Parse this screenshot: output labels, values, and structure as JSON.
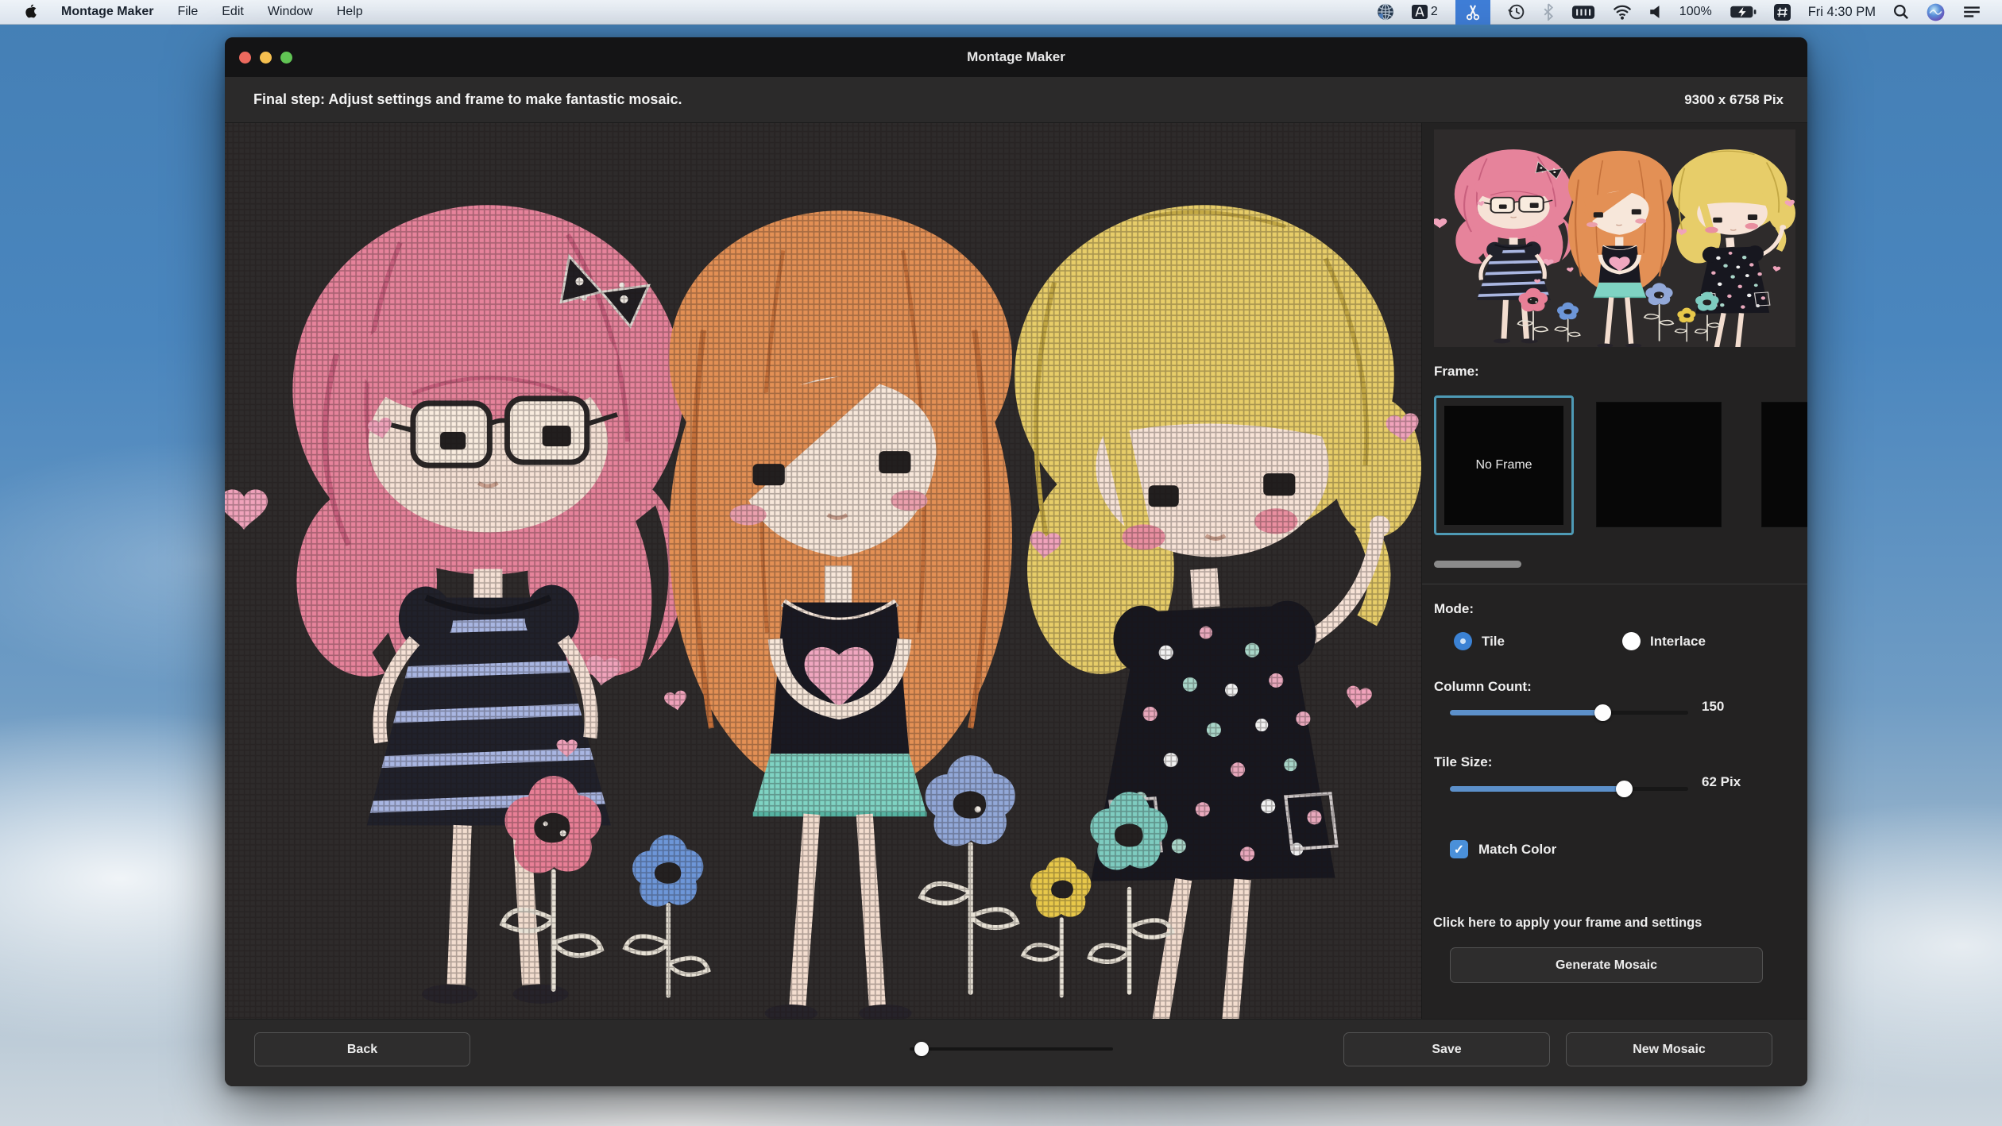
{
  "colors": {
    "accent_blue": "#4a90d9",
    "slider_blue": "#5c90ca",
    "frame_selection": "#4e9ab5",
    "menubar_highlight": "#3f7ed8"
  },
  "menu_bar": {
    "app_name": "Montage Maker",
    "menus": [
      "File",
      "Edit",
      "Window",
      "Help"
    ],
    "status": {
      "adobe_badge": "2",
      "battery_percent": "100%",
      "clock": "Fri 4:30 PM",
      "icons": [
        "globe-icon",
        "adobe-icon",
        "scissors-icon",
        "time-machine-icon",
        "bluetooth-icon",
        "keyboard-brightness-icon",
        "wifi-icon",
        "volume-icon",
        "battery-charging-icon",
        "keypad-icon",
        "spotlight-search-icon",
        "siri-icon",
        "notification-center-icon"
      ]
    }
  },
  "window": {
    "title": "Montage Maker",
    "header": {
      "instruction": "Final step: Adjust settings and frame to make fantastic mosaic.",
      "image_size": "9300 x 6758 Pix"
    },
    "sidebar": {
      "frame_section": {
        "label": "Frame:",
        "options": [
          {
            "label": "No Frame",
            "selected": true
          },
          {
            "label": "",
            "selected": false
          },
          {
            "label": "",
            "selected": false
          }
        ]
      },
      "mode_section": {
        "label": "Mode:",
        "options": [
          {
            "label": "Tile",
            "selected": true
          },
          {
            "label": "Interlace",
            "selected": false
          }
        ]
      },
      "column_count": {
        "label": "Column Count:",
        "value": "150",
        "percent": 64
      },
      "tile_size": {
        "label": "Tile Size:",
        "value": "62 Pix",
        "percent": 73
      },
      "match_color": {
        "label": "Match Color",
        "checked": true
      },
      "apply_hint": "Click here to apply your frame and settings",
      "generate_button": "Generate Mosaic"
    },
    "footer": {
      "back_button": "Back",
      "zoom_slider_percent": 3,
      "save_button": "Save",
      "new_mosaic_button": "New Mosaic"
    }
  }
}
